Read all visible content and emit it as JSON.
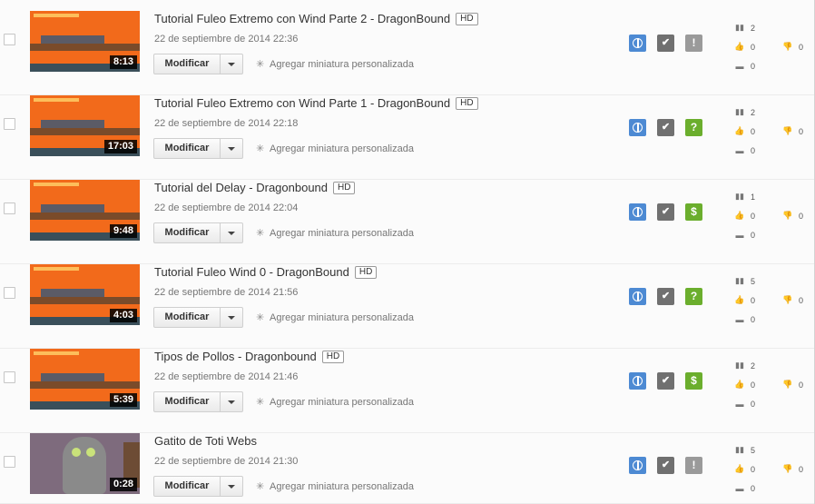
{
  "common": {
    "modify_label": "Modificar",
    "thumb_link": "Agregar miniatura personalizada",
    "check_glyph": "✔",
    "views_icon": "bar-chart-icon",
    "likes_icon": "thumbs-up-icon",
    "dislikes_icon": "thumbs-down-icon",
    "comments_icon": "comment-icon"
  },
  "videos": [
    {
      "title": "Tutorial Fuleo Extremo con Wind Parte 2 - DragonBound",
      "hd": "HD",
      "date": "22 de septiembre de 2014 22:36",
      "duration": "8:13",
      "status_glyph": "!",
      "status": "warning",
      "views": "2",
      "likes": "0",
      "dislikes": "0",
      "comments": "0"
    },
    {
      "title": "Tutorial Fuleo Extremo con Wind Parte 1 - DragonBound",
      "hd": "HD",
      "date": "22 de septiembre de 2014 22:18",
      "duration": "17:03",
      "status_glyph": "?",
      "status": "help",
      "views": "2",
      "likes": "0",
      "dislikes": "0",
      "comments": "0"
    },
    {
      "title": "Tutorial del Delay - Dragonbound",
      "hd": "HD",
      "date": "22 de septiembre de 2014 22:04",
      "duration": "9:48",
      "status_glyph": "$",
      "status": "money",
      "views": "1",
      "likes": "0",
      "dislikes": "0",
      "comments": "0"
    },
    {
      "title": "Tutorial Fuleo Wind 0 - DragonBound",
      "hd": "HD",
      "date": "22 de septiembre de 2014 21:56",
      "duration": "4:03",
      "status_glyph": "?",
      "status": "help",
      "views": "5",
      "likes": "0",
      "dislikes": "0",
      "comments": "0"
    },
    {
      "title": "Tipos de Pollos - Dragonbound",
      "hd": "HD",
      "date": "22 de septiembre de 2014 21:46",
      "duration": "5:39",
      "status_glyph": "$",
      "status": "money",
      "views": "2",
      "likes": "0",
      "dislikes": "0",
      "comments": "0"
    },
    {
      "title": "Gatito de Toti Webs",
      "hd": "",
      "date": "22 de septiembre de 2014 21:30",
      "duration": "0:28",
      "status_glyph": "!",
      "status": "warning",
      "views": "5",
      "likes": "0",
      "dislikes": "0",
      "comments": "0"
    }
  ],
  "colors": {
    "globe": "#4d8ad3",
    "check": "#707070",
    "warning": "#9a9a9a",
    "help": "#6bae2d",
    "money": "#6bae2d",
    "thumb_game": "#f26a1b"
  }
}
